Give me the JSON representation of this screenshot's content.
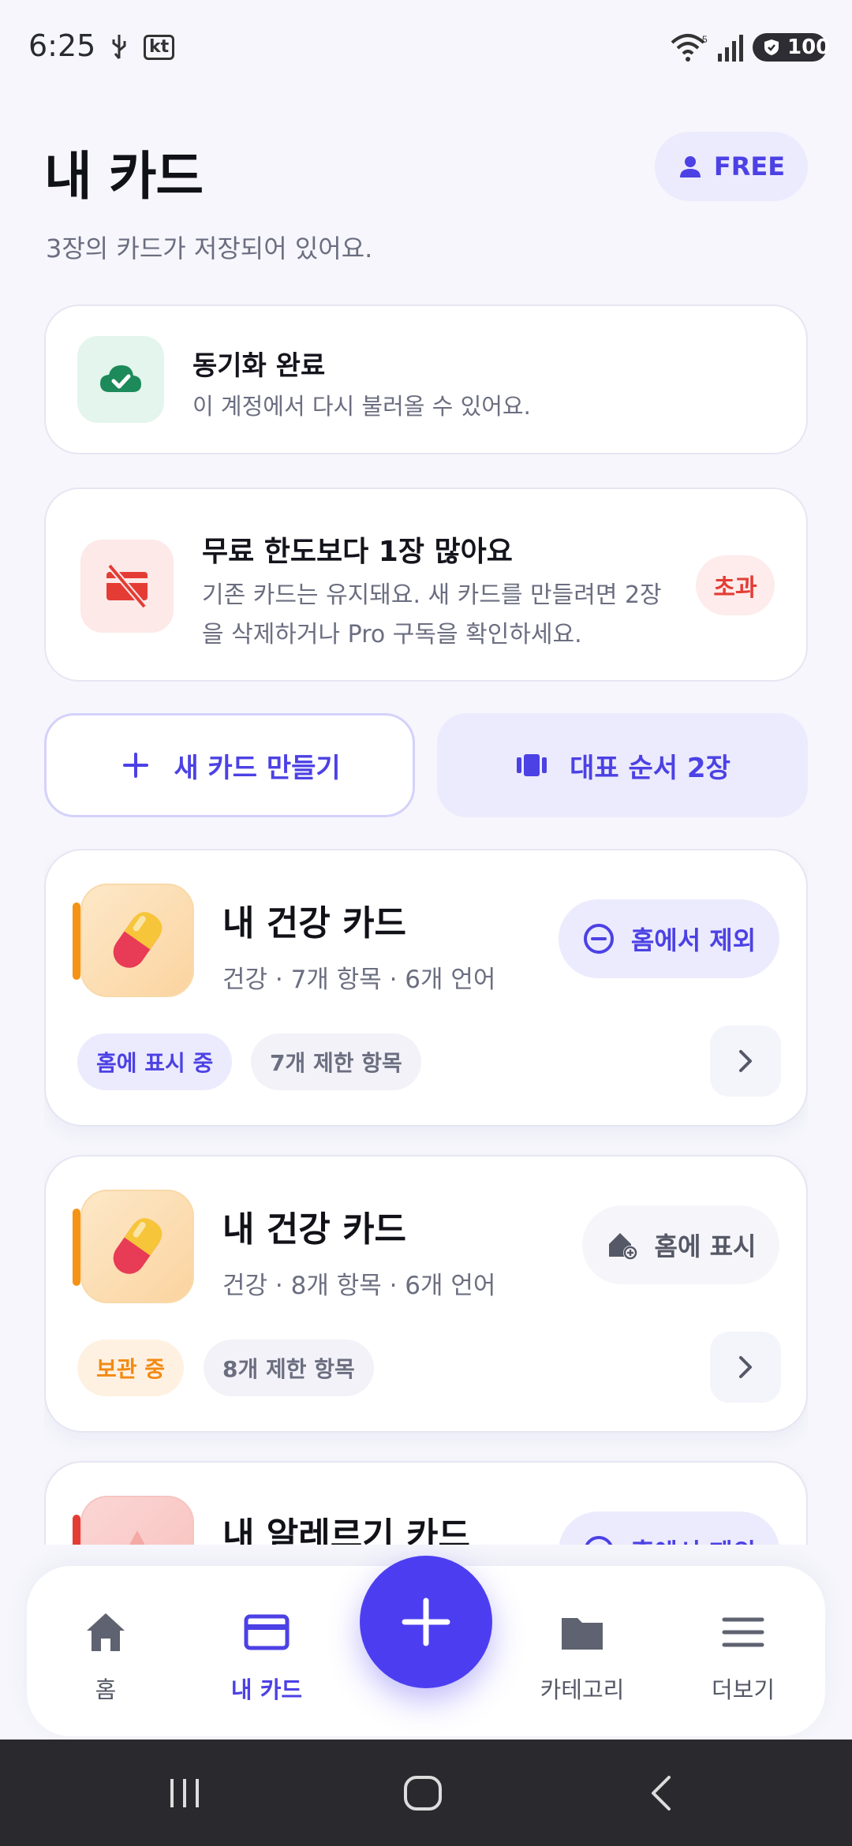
{
  "status_bar": {
    "time": "6:25",
    "carrier": "kt",
    "battery": "100"
  },
  "header": {
    "title": "내 카드",
    "subtitle": "3장의 카드가 저장되어 있어요.",
    "plan_label": "FREE"
  },
  "sync": {
    "title": "동기화 완료",
    "desc": "이 계정에서 다시 불러올 수 있어요."
  },
  "limit": {
    "title": "무료 한도보다 1장 많아요",
    "desc": "기존 카드는 유지돼요. 새 카드를 만들려면 2장을 삭제하거나 Pro 구독을 확인하세요.",
    "badge": "초과"
  },
  "actions": {
    "new_card": "새 카드 만들기",
    "order": "대표 순서 2장"
  },
  "cards": [
    {
      "name": "내 건강 카드",
      "meta": "건강 · 7개 항목 · 6개 언어",
      "home_action": "홈에서 제외",
      "status": "홈에 표시 중",
      "restricted": "7개 제한 항목"
    },
    {
      "name": "내 건강 카드",
      "meta": "건강 · 8개 항목 · 6개 언어",
      "home_action": "홈에 표시",
      "status": "보관 중",
      "restricted": "8개 제한 항목"
    },
    {
      "name": "내 알레르기 카드",
      "home_action": "홈에서 제외"
    }
  ],
  "nav": {
    "home": "홈",
    "my_cards": "내 카드",
    "category": "카테고리",
    "more": "더보기"
  },
  "colors": {
    "accent": "#4c41e4",
    "danger": "#e43c35",
    "warning": "#f28a12",
    "success": "#1c8a5b"
  }
}
